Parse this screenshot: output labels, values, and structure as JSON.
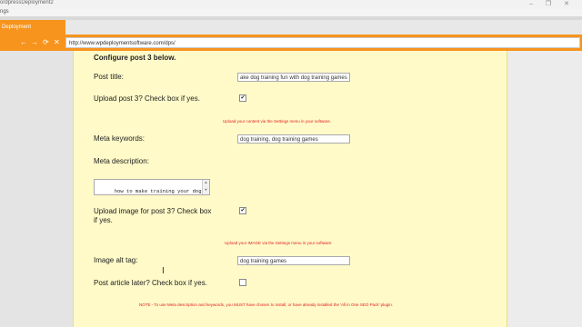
{
  "window": {
    "title": "ordpressDeployment2"
  },
  "menu": {
    "label": "ngs"
  },
  "tab": {
    "label": "Deployment"
  },
  "nav": {
    "back": "←",
    "forward": "→",
    "reload": "⟳",
    "stop": "✕",
    "url": "http://www.wpdeploymentsoftware.com/dps/"
  },
  "form": {
    "header": "Configure post 3 below.",
    "post_title_label": "Post title:",
    "post_title_value": "ake dog training fun with dog training games",
    "upload_post_label": "Upload post 3? Check box if yes.",
    "upload_post_checked": "✔",
    "upload_note": "Upload your content via the Settings menu in your software.",
    "meta_keywords_label": "Meta keywords:",
    "meta_keywords_value": "dog training, dog training games",
    "meta_description_label": "Meta description:",
    "meta_description_value": "how to make training your dog\nfun with dog training games.",
    "upload_image_label_1": "Upload image for post 3? Check box",
    "upload_image_label_2": "if yes.",
    "upload_image_checked": "✔",
    "image_note": "Upload your IMAGE via the Settings menu in your software",
    "image_alt_label": "Image alt tag:",
    "image_alt_value": "dog training games",
    "post_later_label": "Post article later? Check box if yes.",
    "post_later_checked": "",
    "footer_note": "NOTE - To use Meta description and keywords, you MUST have chosen to install, or have already installed the 'All in One SEO Pack' plugin."
  }
}
